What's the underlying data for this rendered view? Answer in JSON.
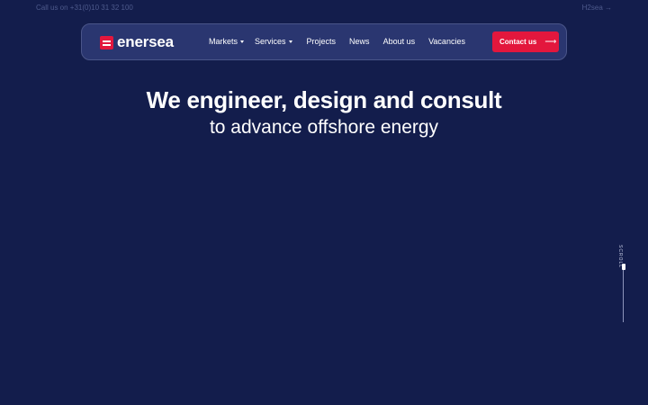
{
  "topbar": {
    "phone_text": "Call us on +31(0)10 31 32 100",
    "h2sea_link": "H2sea →"
  },
  "nav": {
    "logo_text": "enersea",
    "items": [
      {
        "label": "Markets",
        "has_dropdown": true
      },
      {
        "label": "Services",
        "has_dropdown": true
      },
      {
        "label": "Projects",
        "has_dropdown": false
      },
      {
        "label": "News",
        "has_dropdown": false
      },
      {
        "label": "About us",
        "has_dropdown": false
      },
      {
        "label": "Vacancies",
        "has_dropdown": false
      }
    ],
    "cta_label": "Contact us",
    "cta_arrow": "⟶"
  },
  "hero": {
    "title": "We engineer, design and consult",
    "subtitle": "to advance offshore energy"
  },
  "scroll": {
    "label": "SCROLL"
  },
  "colors": {
    "background": "#131d4c",
    "nav_background": "#2a3670",
    "accent": "#e3173d"
  }
}
